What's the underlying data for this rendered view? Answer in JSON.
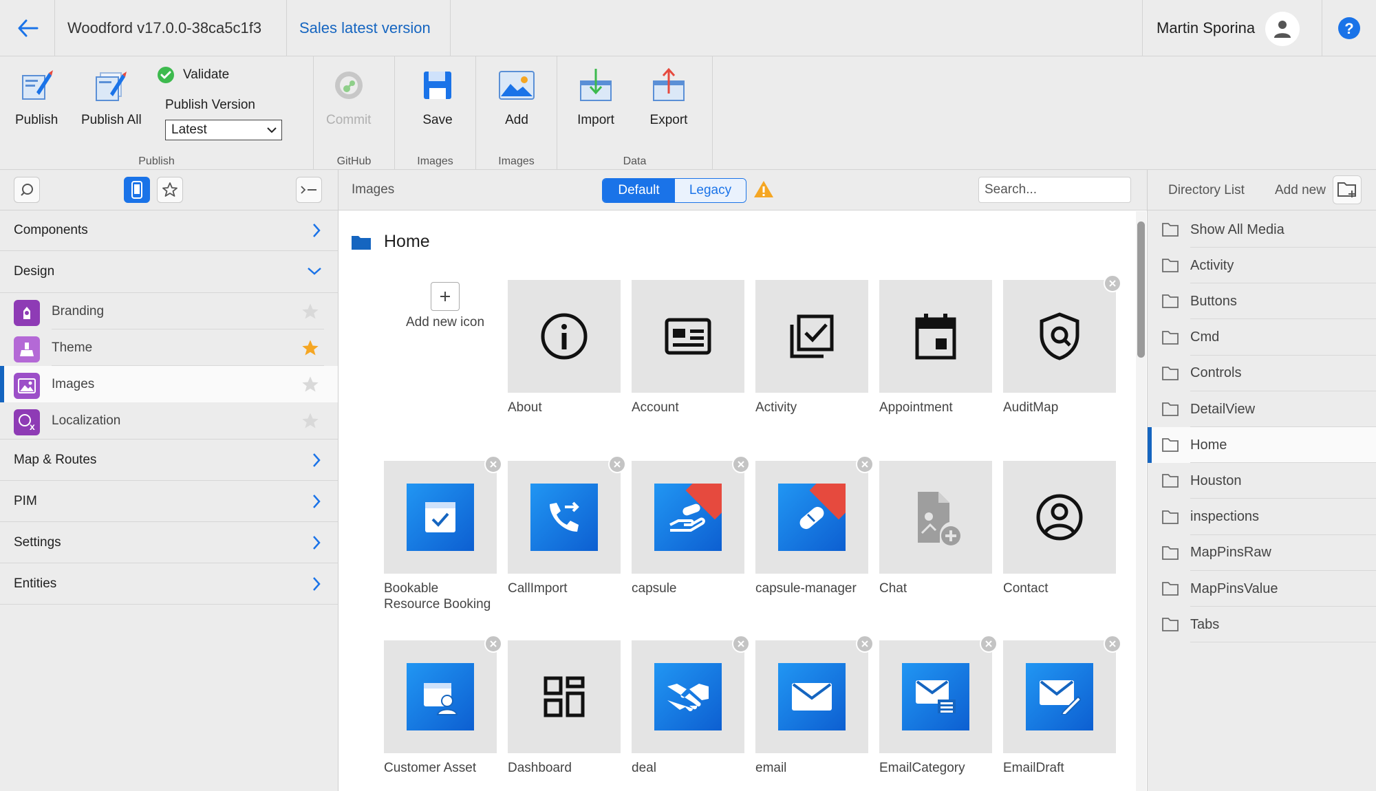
{
  "topbar": {
    "app_title": "Woodford v17.0.0-38ca5c1f3",
    "version_link": "Sales latest version",
    "user_name": "Martin Sporina"
  },
  "ribbon": {
    "publish_label": "Publish",
    "publish_all_label": "Publish All",
    "validate_label": "Validate",
    "publish_version_label": "Publish Version",
    "publish_version_value": "Latest",
    "group_publish": "Publish",
    "commit_label": "Commit",
    "group_github": "GitHub",
    "save_label": "Save",
    "group_images_1": "Images",
    "add_label": "Add",
    "group_images_2": "Images",
    "import_label": "Import",
    "export_label": "Export",
    "group_data": "Data"
  },
  "leftnav": {
    "items": [
      {
        "label": "Components"
      },
      {
        "label": "Design"
      },
      {
        "label": "Map & Routes"
      },
      {
        "label": "PIM"
      },
      {
        "label": "Settings"
      },
      {
        "label": "Entities"
      }
    ],
    "design_sub": [
      {
        "label": "Branding",
        "icon": "branding-icon",
        "starred": false
      },
      {
        "label": "Theme",
        "icon": "theme-icon",
        "starred": true
      },
      {
        "label": "Images",
        "icon": "images-icon",
        "starred": false,
        "active": true
      },
      {
        "label": "Localization",
        "icon": "localization-icon",
        "starred": false
      }
    ]
  },
  "main": {
    "header_title": "Images",
    "seg_default": "Default",
    "seg_legacy": "Legacy",
    "search_placeholder": "Search...",
    "folder_title": "Home",
    "add_new_icon_label": "Add new icon",
    "tiles": [
      {
        "label": "About",
        "icon": "info-icon"
      },
      {
        "label": "Account",
        "icon": "id-card-icon"
      },
      {
        "label": "Activity",
        "icon": "checklist-icon"
      },
      {
        "label": "Appointment",
        "icon": "calendar-icon"
      },
      {
        "label": "AuditMap",
        "icon": "shield-search-icon"
      },
      {
        "label": "Bookable Resource Booking",
        "icon": "calendar-check-icon"
      },
      {
        "label": "CallImport",
        "icon": "phone-forward-icon"
      },
      {
        "label": "capsule",
        "icon": "hand-capsule-icon"
      },
      {
        "label": "capsule-manager",
        "icon": "pill-icon"
      },
      {
        "label": "Chat",
        "icon": "file-add-icon"
      },
      {
        "label": "Contact",
        "icon": "user-circle-icon"
      },
      {
        "label": "Customer Asset",
        "icon": "asset-user-icon"
      },
      {
        "label": "Dashboard",
        "icon": "dashboard-icon"
      },
      {
        "label": "deal",
        "icon": "handshake-icon"
      },
      {
        "label": "email",
        "icon": "envelope-icon"
      },
      {
        "label": "EmailCategory",
        "icon": "envelope-list-icon"
      },
      {
        "label": "EmailDraft",
        "icon": "envelope-edit-icon"
      }
    ]
  },
  "rightpanel": {
    "directory_list_label": "Directory List",
    "add_new_label": "Add new",
    "dirs": [
      "Show All Media",
      "Activity",
      "Buttons",
      "Cmd",
      "Controls",
      "DetailView",
      "Home",
      "Houston",
      "inspections",
      "MapPinsRaw",
      "MapPinsValue",
      "Tabs"
    ],
    "active_dir": "Home"
  },
  "colors": {
    "accent": "#1a73e8",
    "active_bar": "#1565c0",
    "star_active": "#f5a623",
    "warning": "#f5a623",
    "validate_ok": "#3dba4e",
    "tile_bg": "#e4e4e4"
  }
}
